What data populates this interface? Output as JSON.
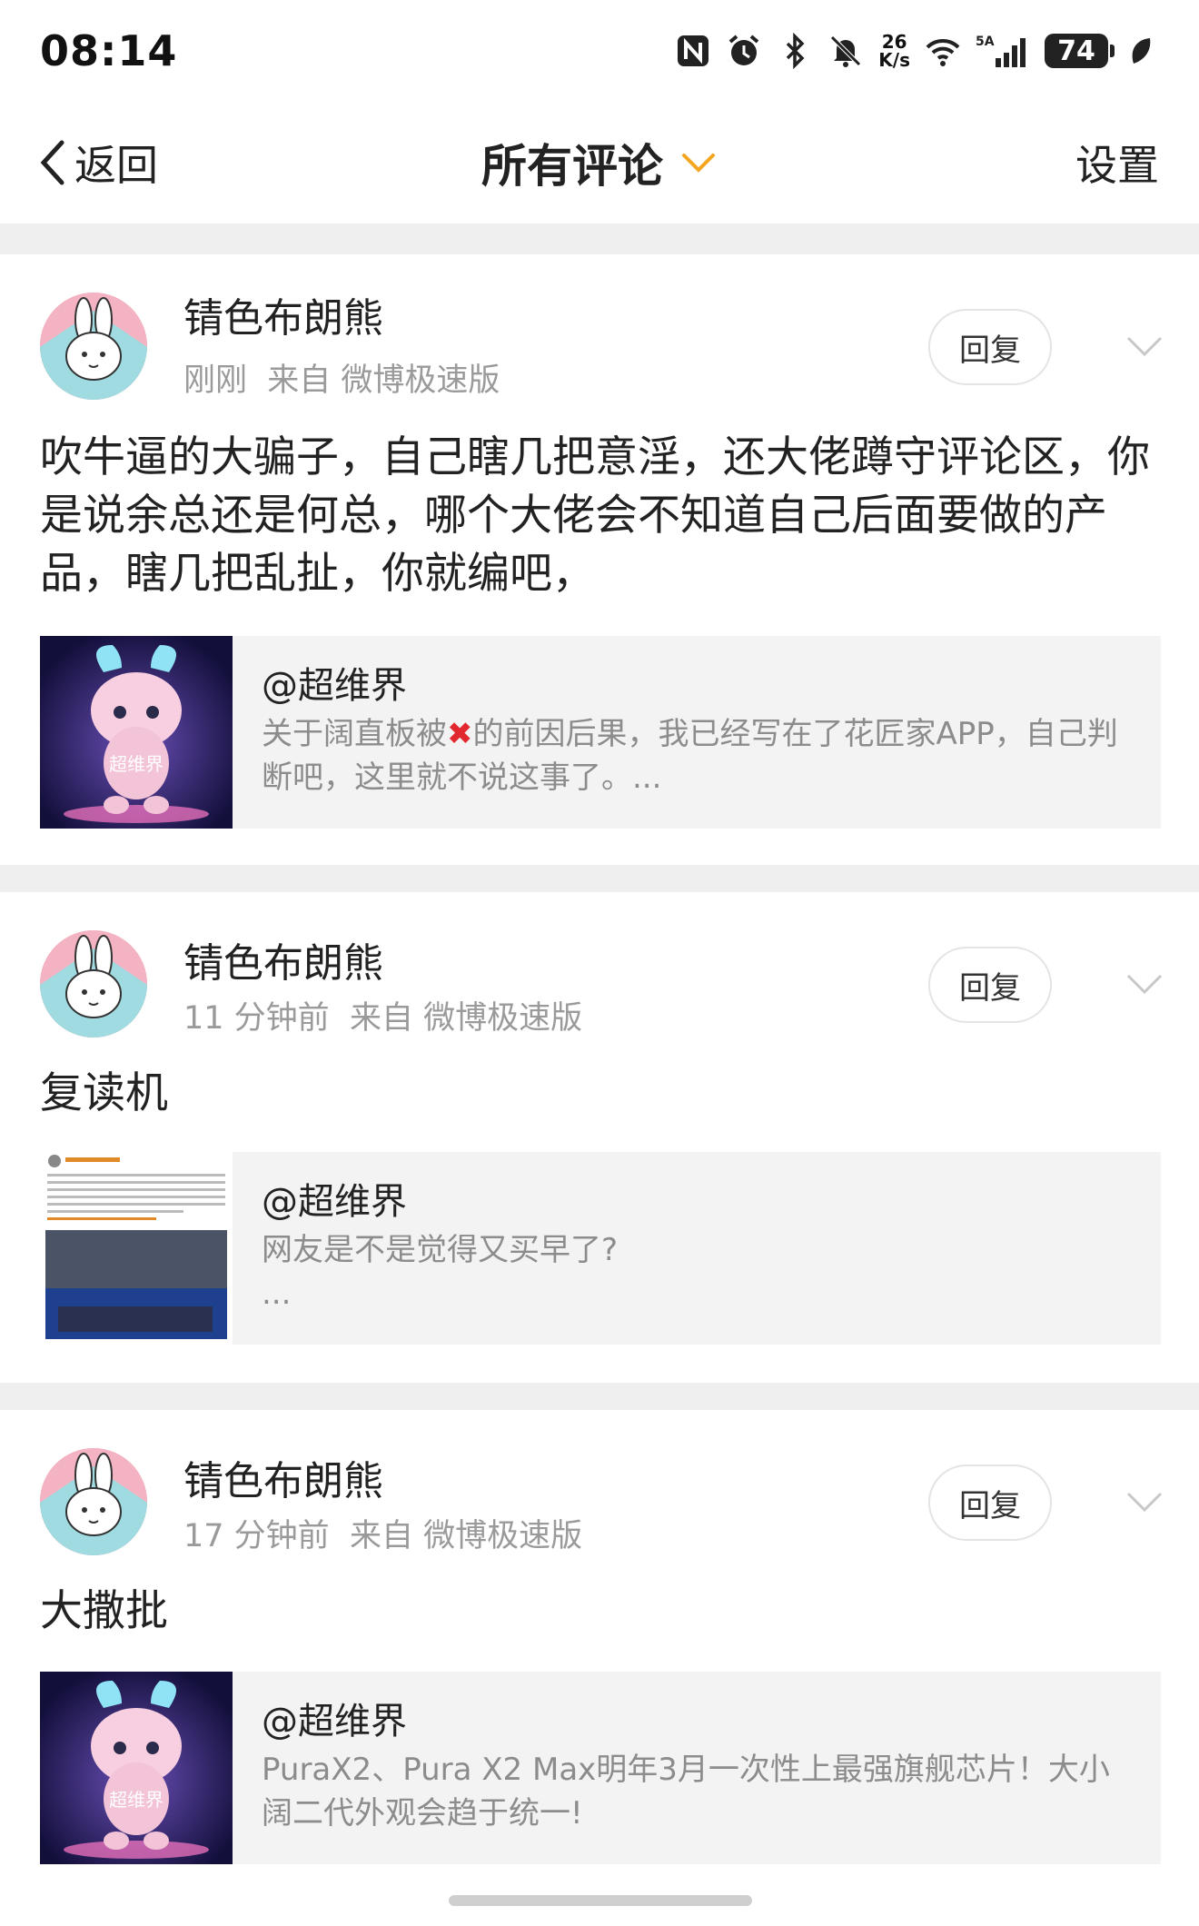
{
  "status": {
    "time": "08:14",
    "net_speed_top": "26",
    "net_speed_bottom": "K/s",
    "signal_label": "5A",
    "battery": "74"
  },
  "nav": {
    "back_label": "返回",
    "title": "所有评论",
    "settings_label": "设置"
  },
  "colors": {
    "accent": "#f4a623",
    "gray_text": "#9a9a9a",
    "separator": "#efefef",
    "quote_bg": "#f3f3f3"
  },
  "comments": [
    {
      "username": "锖色布朗熊",
      "time": "刚刚",
      "source": "来自 微博极速版",
      "reply_label": "回复",
      "content": "吹牛逼的大骗子，自己瞎几把意淫，还大佬蹲守评论区，你是说余总还是何总，哪个大佬会不知道自己后面要做的产品，瞎几把乱扯，你就编吧，",
      "quote": {
        "author": "@超维界",
        "text_before": "关于阔直板被",
        "text_after": "的前因后果，我已经写在了花匠家APP，自己判断吧，这里就不说这事了。...",
        "image_label": "超维界"
      }
    },
    {
      "username": "锖色布朗熊",
      "time": "11 分钟前",
      "source": "来自 微博极速版",
      "reply_label": "回复",
      "content": "复读机",
      "quote": {
        "author": "@超维界",
        "text": "网友是不是觉得又买早了?",
        "ellipsis": "..."
      }
    },
    {
      "username": "锖色布朗熊",
      "time": "17 分钟前",
      "source": "来自 微博极速版",
      "reply_label": "回复",
      "content": "大撒批",
      "quote": {
        "author": "@超维界",
        "text": "PuraX2、Pura X2 Max明年3月一次性上最强旗舰芯片！大小阔二代外观会趋于统一!",
        "image_label": "超维界"
      }
    }
  ]
}
